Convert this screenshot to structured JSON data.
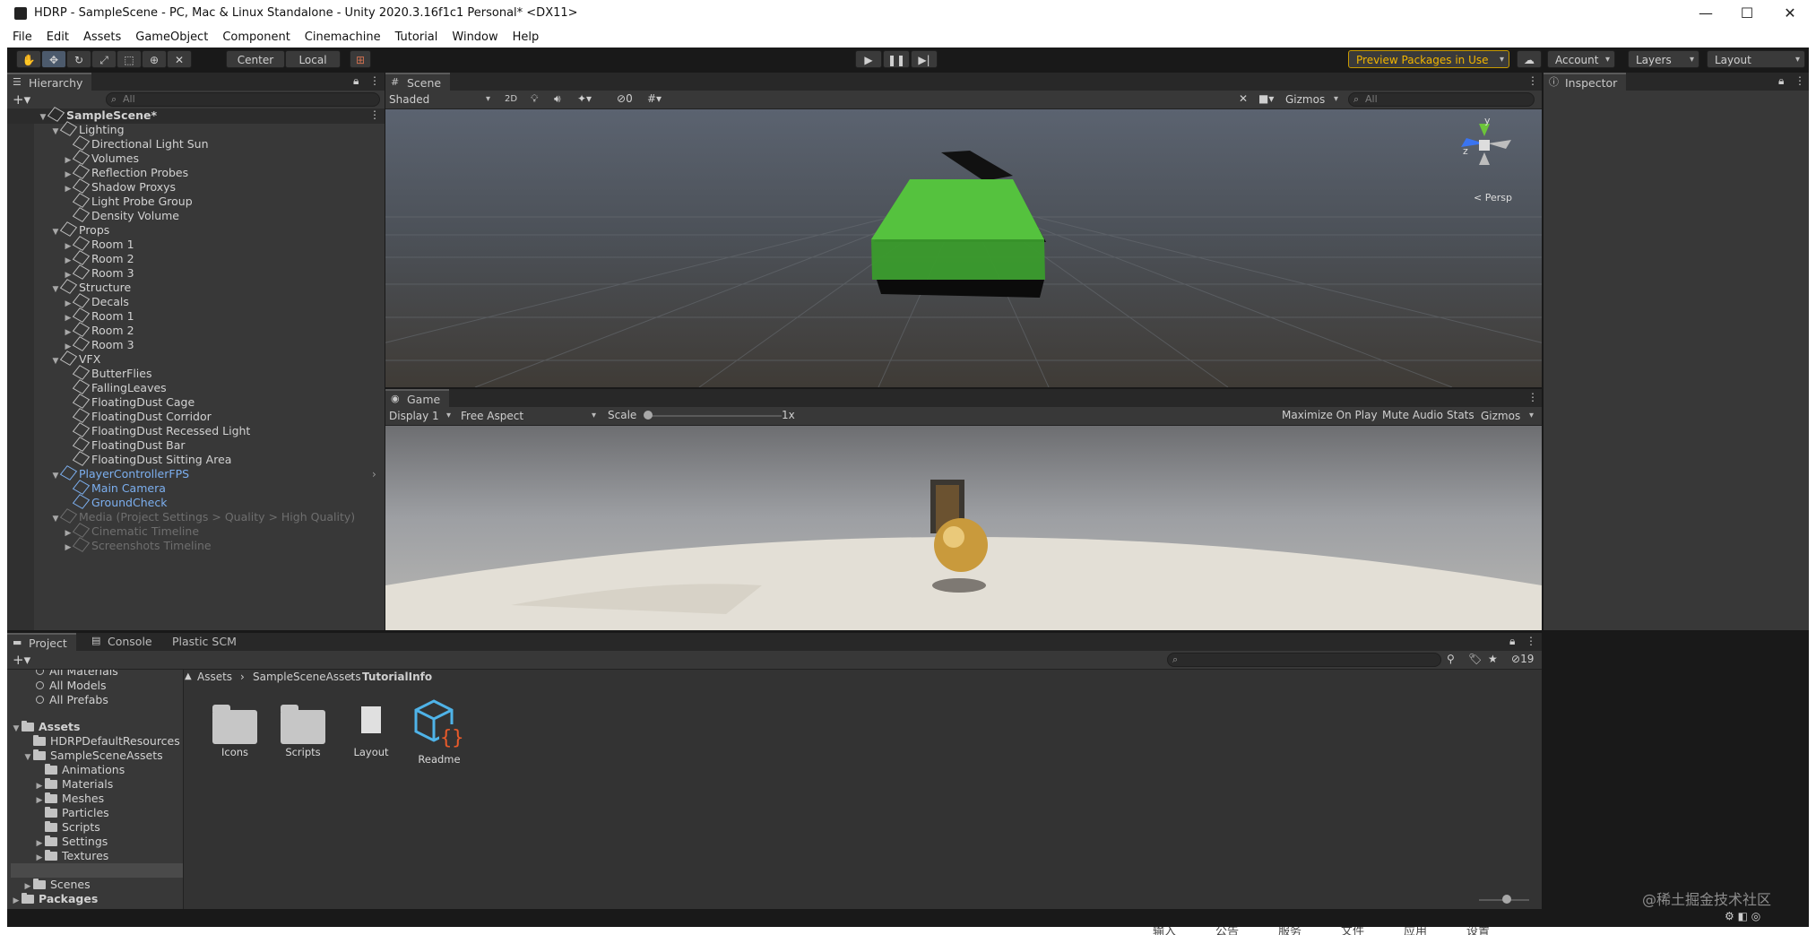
{
  "window": {
    "title": "HDRP - SampleScene - PC, Mac & Linux Standalone - Unity 2020.3.16f1c1 Personal* <DX11>",
    "minimize": "—",
    "maximize": "☐",
    "close": "✕"
  },
  "menu": [
    "File",
    "Edit",
    "Assets",
    "GameObject",
    "Component",
    "Cinemachine",
    "Tutorial",
    "Window",
    "Help"
  ],
  "toolbar": {
    "pivot": "Center",
    "space": "Local",
    "preview_packages": "Preview Packages in Use",
    "account": "Account",
    "layers": "Layers",
    "layout": "Layout"
  },
  "hierarchy": {
    "tab": "Hierarchy",
    "search_placeholder": "All",
    "scene": "SampleScene*",
    "items": [
      {
        "label": "Lighting",
        "depth": 1,
        "arrow": "▼",
        "style": ""
      },
      {
        "label": "Directional Light Sun",
        "depth": 2,
        "arrow": "",
        "style": ""
      },
      {
        "label": "Volumes",
        "depth": 2,
        "arrow": "▶",
        "style": ""
      },
      {
        "label": "Reflection Probes",
        "depth": 2,
        "arrow": "▶",
        "style": ""
      },
      {
        "label": "Shadow Proxys",
        "depth": 2,
        "arrow": "▶",
        "style": ""
      },
      {
        "label": "Light Probe Group",
        "depth": 2,
        "arrow": "",
        "style": ""
      },
      {
        "label": "Density Volume",
        "depth": 2,
        "arrow": "",
        "style": ""
      },
      {
        "label": "Props",
        "depth": 1,
        "arrow": "▼",
        "style": ""
      },
      {
        "label": "Room 1",
        "depth": 2,
        "arrow": "▶",
        "style": ""
      },
      {
        "label": "Room 2",
        "depth": 2,
        "arrow": "▶",
        "style": ""
      },
      {
        "label": "Room 3",
        "depth": 2,
        "arrow": "▶",
        "style": ""
      },
      {
        "label": "Structure",
        "depth": 1,
        "arrow": "▼",
        "style": ""
      },
      {
        "label": "Decals",
        "depth": 2,
        "arrow": "▶",
        "style": ""
      },
      {
        "label": "Room 1",
        "depth": 2,
        "arrow": "▶",
        "style": ""
      },
      {
        "label": "Room 2",
        "depth": 2,
        "arrow": "▶",
        "style": ""
      },
      {
        "label": "Room 3",
        "depth": 2,
        "arrow": "▶",
        "style": ""
      },
      {
        "label": "VFX",
        "depth": 1,
        "arrow": "▼",
        "style": ""
      },
      {
        "label": "ButterFlies",
        "depth": 2,
        "arrow": "",
        "style": ""
      },
      {
        "label": "FallingLeaves",
        "depth": 2,
        "arrow": "",
        "style": ""
      },
      {
        "label": "FloatingDust Cage",
        "depth": 2,
        "arrow": "",
        "style": ""
      },
      {
        "label": "FloatingDust Corridor",
        "depth": 2,
        "arrow": "",
        "style": ""
      },
      {
        "label": "FloatingDust Recessed Light",
        "depth": 2,
        "arrow": "",
        "style": ""
      },
      {
        "label": "FloatingDust Bar",
        "depth": 2,
        "arrow": "",
        "style": ""
      },
      {
        "label": "FloatingDust Sitting Area",
        "depth": 2,
        "arrow": "",
        "style": ""
      },
      {
        "label": "PlayerControllerFPS",
        "depth": 1,
        "arrow": "▼",
        "style": "blue"
      },
      {
        "label": "Main Camera",
        "depth": 2,
        "arrow": "",
        "style": "blue"
      },
      {
        "label": "GroundCheck",
        "depth": 2,
        "arrow": "",
        "style": "blue"
      },
      {
        "label": "Media (Project Settings > Quality > High Quality)",
        "depth": 1,
        "arrow": "▼",
        "style": "dim"
      },
      {
        "label": "Cinematic Timeline",
        "depth": 2,
        "arrow": "▶",
        "style": "dim"
      },
      {
        "label": "Screenshots Timeline",
        "depth": 2,
        "arrow": "▶",
        "style": "dim"
      }
    ]
  },
  "scene_view": {
    "tab": "Scene",
    "shading": "Shaded",
    "mode_2d": "2D",
    "hidden_count": "0",
    "gizmos": "Gizmos",
    "search_placeholder": "All",
    "persp_label": "< Persp",
    "axis_y": "y",
    "axis_z": "z"
  },
  "game_view": {
    "tab": "Game",
    "display": "Display 1",
    "aspect": "Free Aspect",
    "scale_label": "Scale",
    "scale_value": "1x",
    "maximize_on_play": "Maximize On Play",
    "mute_audio": "Mute Audio",
    "stats": "Stats",
    "gizmos": "Gizmos"
  },
  "inspector": {
    "tab": "Inspector"
  },
  "project": {
    "tabs": [
      "Project",
      "Console",
      "Plastic SCM"
    ],
    "hidden_count": "19",
    "favorites": [
      "All Materials",
      "All Models",
      "All Prefabs"
    ],
    "tree": [
      {
        "label": "Assets",
        "depth": 0,
        "arrow": "▼",
        "bold": true
      },
      {
        "label": "HDRPDefaultResources",
        "depth": 1,
        "arrow": "",
        "bold": false
      },
      {
        "label": "SampleSceneAssets",
        "depth": 1,
        "arrow": "▼",
        "bold": false
      },
      {
        "label": "Animations",
        "depth": 2,
        "arrow": "",
        "bold": false
      },
      {
        "label": "Materials",
        "depth": 2,
        "arrow": "▶",
        "bold": false
      },
      {
        "label": "Meshes",
        "depth": 2,
        "arrow": "▶",
        "bold": false
      },
      {
        "label": "Particles",
        "depth": 2,
        "arrow": "",
        "bold": false
      },
      {
        "label": "Scripts",
        "depth": 2,
        "arrow": "",
        "bold": false
      },
      {
        "label": "Settings",
        "depth": 2,
        "arrow": "▶",
        "bold": false
      },
      {
        "label": "Textures",
        "depth": 2,
        "arrow": "▶",
        "bold": false
      },
      {
        "label": "TutorialInfo",
        "depth": 2,
        "arrow": "▶",
        "bold": false
      },
      {
        "label": "Scenes",
        "depth": 1,
        "arrow": "▶",
        "bold": false
      },
      {
        "label": "Packages",
        "depth": 0,
        "arrow": "▶",
        "bold": true
      }
    ],
    "breadcrumb": [
      "Assets",
      "SampleSceneAssets",
      "TutorialInfo"
    ],
    "assets": [
      {
        "label": "Icons",
        "kind": "folder"
      },
      {
        "label": "Scripts",
        "kind": "folder"
      },
      {
        "label": "Layout",
        "kind": "file"
      },
      {
        "label": "Readme",
        "kind": "readme"
      }
    ]
  },
  "watermark": "@稀土掘金技术社区",
  "taskbar_text": [
    "输入",
    "公告",
    "服务",
    "文件",
    "应用",
    "设置"
  ]
}
